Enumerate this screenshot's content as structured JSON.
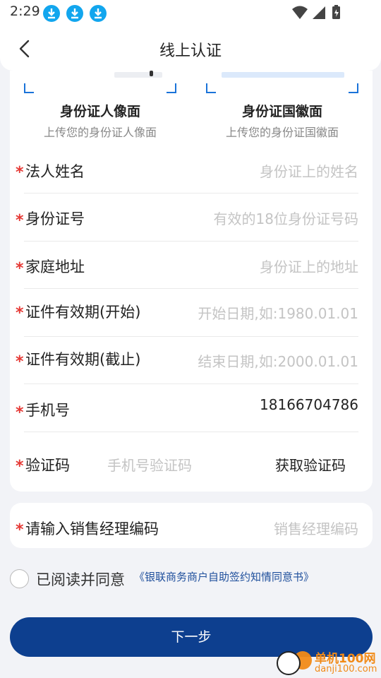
{
  "status_bar": {
    "time": "2:29",
    "icons": [
      "download-icon",
      "download-icon",
      "download-icon",
      "wifi-icon",
      "signal-icon",
      "battery-charging-icon"
    ]
  },
  "nav": {
    "title": "线上认证",
    "back_icon": "chevron-left-icon"
  },
  "id_cards": {
    "front": {
      "title": "身份证人像面",
      "subtitle": "上传您的身份证人像面"
    },
    "back": {
      "title": "身份证国徽面",
      "subtitle": "上传您的身份证国徽面"
    }
  },
  "form": {
    "legal_name": {
      "label": "法人姓名",
      "placeholder": "身份证上的姓名"
    },
    "id_number": {
      "label": "身份证号",
      "placeholder": "有效的18位身份证号码"
    },
    "address": {
      "label": "家庭地址",
      "placeholder": "身份证上的地址"
    },
    "valid_start": {
      "label": "证件有效期(开始)",
      "placeholder": "开始日期,如:1980.01.01"
    },
    "valid_end": {
      "label": "证件有效期(截止)",
      "placeholder": "结束日期,如:2000.01.01"
    },
    "phone": {
      "label": "手机号",
      "value": "18166704786"
    },
    "code": {
      "label": "验证码",
      "placeholder": "手机号验证码",
      "action": "获取验证码"
    },
    "manager_code": {
      "label": "请输入销售经理编码",
      "placeholder": "销售经理编码"
    }
  },
  "required_mark": "*",
  "agreement": {
    "text": "已阅读并同意",
    "link": "《银联商务商户自助签约知情同意书》"
  },
  "next_button": "下一步",
  "watermark": {
    "brand": "单机100网",
    "url": "danji100.com"
  },
  "colors": {
    "primary": "#0d3f8f",
    "accent_blue": "#1a73d9",
    "required": "#e53935",
    "placeholder": "#c4c4c4",
    "link": "#1f4f9c"
  }
}
